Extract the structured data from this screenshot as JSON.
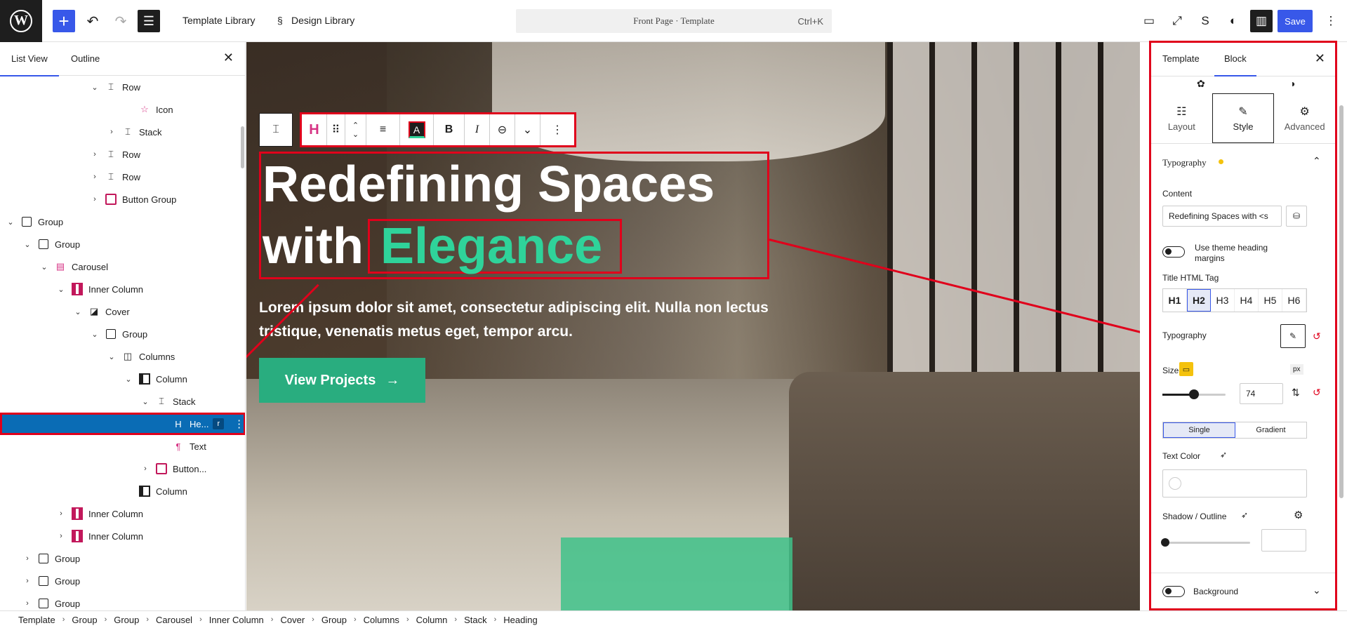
{
  "topbar": {
    "logo": "W",
    "template_library": "Template Library",
    "design_library": "Design Library",
    "command": "Front Page · Template",
    "shortcut": "Ctrl+K",
    "save": "Save"
  },
  "left_panel": {
    "tabs": [
      "List View",
      "Outline"
    ],
    "tree": [
      {
        "label": "Row",
        "indent": 5,
        "chevron": "down",
        "icon": "row"
      },
      {
        "label": "Icon",
        "indent": 7,
        "chevron": "",
        "icon": "star"
      },
      {
        "label": "Stack",
        "indent": 6,
        "chevron": "right",
        "icon": "stack"
      },
      {
        "label": "Row",
        "indent": 5,
        "chevron": "right",
        "icon": "row"
      },
      {
        "label": "Row",
        "indent": 5,
        "chevron": "right",
        "icon": "row"
      },
      {
        "label": "Button Group",
        "indent": 5,
        "chevron": "right",
        "icon": "buttons"
      },
      {
        "label": "Group",
        "indent": 0,
        "chevron": "down",
        "icon": "group"
      },
      {
        "label": "Group",
        "indent": 1,
        "chevron": "down",
        "icon": "group"
      },
      {
        "label": "Carousel",
        "indent": 2,
        "chevron": "down",
        "icon": "carousel"
      },
      {
        "label": "Inner Column",
        "indent": 3,
        "chevron": "down",
        "icon": "innercol"
      },
      {
        "label": "Cover",
        "indent": 4,
        "chevron": "down",
        "icon": "cover"
      },
      {
        "label": "Group",
        "indent": 5,
        "chevron": "down",
        "icon": "group"
      },
      {
        "label": "Columns",
        "indent": 6,
        "chevron": "down",
        "icon": "columns"
      },
      {
        "label": "Column",
        "indent": 7,
        "chevron": "down",
        "icon": "column"
      },
      {
        "label": "Stack",
        "indent": 8,
        "chevron": "down",
        "icon": "stack"
      },
      {
        "label": "He...",
        "indent": 9,
        "chevron": "",
        "icon": "heading",
        "selected": true,
        "chip": "r"
      },
      {
        "label": "Text",
        "indent": 9,
        "chevron": "",
        "icon": "paragraph"
      },
      {
        "label": "Button...",
        "indent": 8,
        "chevron": "right",
        "icon": "buttons"
      },
      {
        "label": "Column",
        "indent": 7,
        "chevron": "",
        "icon": "column"
      },
      {
        "label": "Inner Column",
        "indent": 3,
        "chevron": "right",
        "icon": "innercol"
      },
      {
        "label": "Inner Column",
        "indent": 3,
        "chevron": "right",
        "icon": "innercol"
      },
      {
        "label": "Group",
        "indent": 1,
        "chevron": "right",
        "icon": "group"
      },
      {
        "label": "Group",
        "indent": 1,
        "chevron": "right",
        "icon": "group"
      },
      {
        "label": "Group",
        "indent": 1,
        "chevron": "right",
        "icon": "group"
      }
    ]
  },
  "canvas": {
    "title_line1": "Redefining Spaces",
    "title_line2_plain": "with",
    "title_accent": "Elegance",
    "subtitle": "Lorem ipsum dolor sit amet, consectetur adipiscing elit. Nulla non lectus tristique, venenatis metus eget, tempor arcu.",
    "button": "View Projects",
    "button_arrow": "→",
    "accent_color": "#2fd39a"
  },
  "right_panel": {
    "tabs": [
      "Template",
      "Block"
    ],
    "subtabs": [
      "Layout",
      "Style",
      "Advanced"
    ],
    "typography_section": "Typography",
    "content_label": "Content",
    "content_value": "Redefining Spaces with <s",
    "theme_margins_label": "Use theme heading margins",
    "html_tag_label": "Title HTML Tag",
    "html_tags": [
      "H1",
      "H2",
      "H3",
      "H4",
      "H5",
      "H6"
    ],
    "active_tag": "H2",
    "typography_label": "Typography",
    "size_label": "Size",
    "size_unit": "px",
    "size_value": "74",
    "size_slider_fraction": 0.5,
    "color_modes": [
      "Single",
      "Gradient"
    ],
    "text_color_label": "Text Color",
    "shadow_label": "Shadow / Outline",
    "background_label": "Background"
  },
  "breadcrumb": [
    "Template",
    "Group",
    "Group",
    "Carousel",
    "Inner Column",
    "Cover",
    "Group",
    "Columns",
    "Column",
    "Stack",
    "Heading"
  ]
}
